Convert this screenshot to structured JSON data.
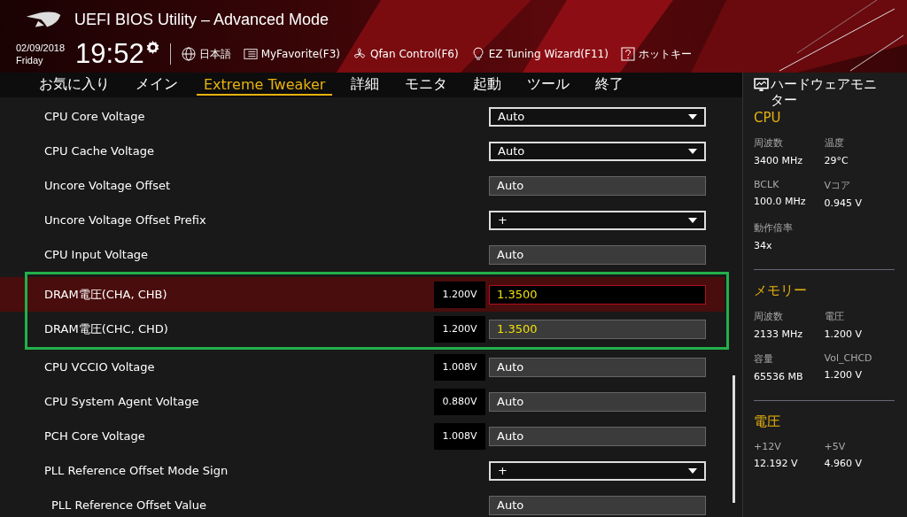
{
  "header": {
    "title": "UEFI BIOS Utility – Advanced Mode",
    "date": "02/09/2018",
    "day": "Friday",
    "time": "19:52",
    "tools": [
      {
        "kind": "language",
        "label": "日本語"
      },
      {
        "kind": "favorite",
        "label": "MyFavorite(F3)"
      },
      {
        "kind": "fan",
        "label": "Qfan Control(F6)"
      },
      {
        "kind": "wizard",
        "label": "EZ Tuning Wizard(F11)"
      },
      {
        "kind": "hotkey",
        "label": "ホットキー"
      }
    ]
  },
  "tabs": [
    {
      "label": "お気に入り",
      "selected": false
    },
    {
      "label": "メイン",
      "selected": false
    },
    {
      "label": "Extreme Tweaker",
      "selected": true
    },
    {
      "label": "詳細",
      "selected": false
    },
    {
      "label": "モニタ",
      "selected": false
    },
    {
      "label": "起動",
      "selected": false
    },
    {
      "label": "ツール",
      "selected": false
    },
    {
      "label": "終了",
      "selected": false
    }
  ],
  "settings": [
    {
      "label": "CPU Core Voltage",
      "kind": "dropdown",
      "value": "Auto",
      "selected": false,
      "boxed": false
    },
    {
      "label": "CPU Cache Voltage",
      "kind": "dropdown",
      "value": "Auto",
      "selected": false,
      "boxed": false
    },
    {
      "label": "Uncore Voltage Offset",
      "kind": "field",
      "value": "Auto",
      "selected": false,
      "boxed": false
    },
    {
      "label": "Uncore Voltage Offset Prefix",
      "kind": "dropdown",
      "value": "+",
      "selected": false,
      "boxed": false
    },
    {
      "label": "CPU Input Voltage",
      "kind": "field",
      "value": "Auto",
      "selected": false,
      "boxed": false
    },
    {
      "label": "DRAM電圧(CHA, CHB)",
      "kind": "field",
      "reading": "1.200V",
      "value": "1.3500",
      "changed": true,
      "selected": true,
      "boxed": true
    },
    {
      "label": "DRAM電圧(CHC, CHD)",
      "kind": "field",
      "reading": "1.200V",
      "value": "1.3500",
      "changed": true,
      "selected": false,
      "boxed": true
    },
    {
      "label": "CPU VCCIO Voltage",
      "kind": "field",
      "reading": "1.008V",
      "value": "Auto",
      "selected": false,
      "boxed": false
    },
    {
      "label": "CPU System Agent Voltage",
      "kind": "field",
      "reading": "0.880V",
      "value": "Auto",
      "selected": false,
      "boxed": false
    },
    {
      "label": "PCH Core Voltage",
      "kind": "field",
      "reading": "1.008V",
      "value": "Auto",
      "selected": false,
      "boxed": false
    },
    {
      "label": "PLL Reference Offset Mode Sign",
      "kind": "dropdown",
      "value": "+",
      "selected": false,
      "boxed": false,
      "children": [
        {
          "label": "PLL Reference Offset Value",
          "kind": "field",
          "value": "Auto",
          "selected": false,
          "boxed": false
        }
      ]
    }
  ],
  "monitor": {
    "title": "ハードウェアモニター",
    "sections": [
      {
        "title": "CPU",
        "items": [
          {
            "label": "周波数",
            "value": "3400 MHz"
          },
          {
            "label": "温度",
            "value": "29°C"
          },
          {
            "label": "BCLK",
            "value": "100.0 MHz"
          },
          {
            "label": "Vコア",
            "value": "0.945 V"
          },
          {
            "label": "動作倍率",
            "value": "34x"
          }
        ]
      },
      {
        "title": "メモリー",
        "items": [
          {
            "label": "周波数",
            "value": "2133 MHz"
          },
          {
            "label": "電圧",
            "value": "1.200 V"
          },
          {
            "label": "容量",
            "value": "65536 MB"
          },
          {
            "label": "Vol_CHCD",
            "value": "1.200 V"
          }
        ]
      },
      {
        "title": "電圧",
        "items": [
          {
            "label": "+12V",
            "value": "12.192 V"
          },
          {
            "label": "+5V",
            "value": "4.960 V"
          }
        ]
      }
    ]
  }
}
